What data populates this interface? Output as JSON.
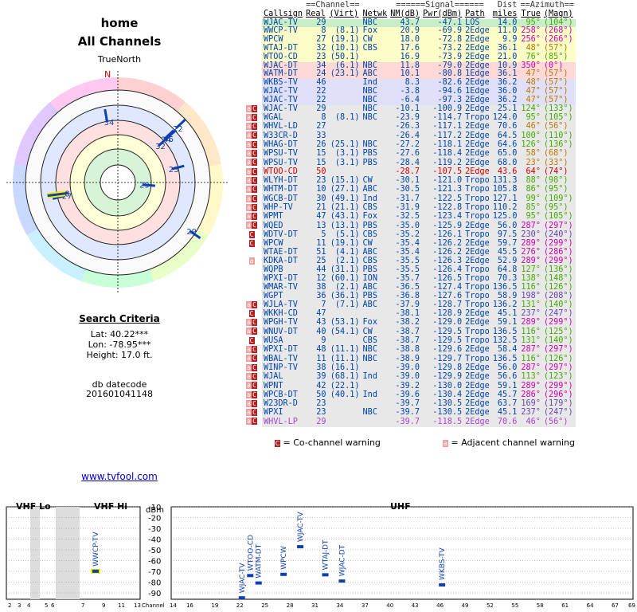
{
  "header": {
    "title": "home",
    "subtitle": "All Channels",
    "true_north": "TrueNorth",
    "north_label": "N"
  },
  "criteria": {
    "title": "Search Criteria",
    "lat": "Lat: 40.22***",
    "lon": "Lon: -78.95***",
    "height": "Height: 17.0 ft.",
    "db_label": "db datecode",
    "db_code": "201601041148"
  },
  "footer_link": "www.tvfool.com",
  "legend": {
    "co": "= Co-channel warning",
    "adj": "= Adjacent channel warning",
    "co_icon": "C",
    "adj_icon": "a"
  },
  "table": {
    "group_headers": [
      "==Channel==",
      "======Signal======",
      "Dist",
      "==Azimuth=="
    ],
    "headers": [
      "Callsign",
      "Real",
      "(Virt)",
      "Netwk",
      "NM(dB)",
      "Pwr(dBm)",
      "Path",
      "miles",
      "True",
      "(Magn)"
    ],
    "rows": [
      {
        "w": "",
        "cs": "WJAC-TV",
        "real": "29",
        "virt": "",
        "net": "NBC",
        "nm": "43.7",
        "pwr": "-47.1",
        "path": "LOS",
        "dist": "14.0",
        "az": "95°",
        "mag": "(104°)"
      },
      {
        "w": "",
        "cs": "WWCP-TV",
        "real": "8",
        "virt": "(8.1)",
        "net": "Fox",
        "nm": "20.9",
        "pwr": "-69.9",
        "path": "2Edge",
        "dist": "11.0",
        "az": "258°",
        "mag": "(268°)"
      },
      {
        "w": "",
        "cs": "WPCW",
        "real": "27",
        "virt": "(19.1)",
        "net": "CW",
        "nm": "18.0",
        "pwr": "-72.8",
        "path": "2Edge",
        "dist": "9.9",
        "az": "256°",
        "mag": "(266°)"
      },
      {
        "w": "",
        "cs": "WTAJ-DT",
        "real": "32",
        "virt": "(10.1)",
        "net": "CBS",
        "nm": "17.6",
        "pwr": "-73.2",
        "path": "2Edge",
        "dist": "36.1",
        "az": "48°",
        "mag": "(57°)"
      },
      {
        "w": "",
        "cs": "WTOO-CD",
        "real": "23",
        "virt": "(50.1)",
        "net": "",
        "nm": "16.9",
        "pwr": "-73.9",
        "path": "2Edge",
        "dist": "21.0",
        "az": "76°",
        "mag": "(85°)"
      },
      {
        "w": "",
        "cs": "WJAC-DT",
        "real": "34",
        "virt": "(6.1)",
        "net": "NBC",
        "nm": "11.8",
        "pwr": "-79.0",
        "path": "2Edge",
        "dist": "10.9",
        "az": "350°",
        "mag": "(0°)"
      },
      {
        "w": "",
        "cs": "WATM-DT",
        "real": "24",
        "virt": "(23.1)",
        "net": "ABC",
        "nm": "10.1",
        "pwr": "-80.8",
        "path": "1Edge",
        "dist": "36.1",
        "az": "47°",
        "mag": "(57°)"
      },
      {
        "w": "",
        "cs": "WKBS-TV",
        "real": "46",
        "virt": "",
        "net": "Ind",
        "nm": "8.3",
        "pwr": "-82.6",
        "path": "2Edge",
        "dist": "36.2",
        "az": "48°",
        "mag": "(57°)"
      },
      {
        "w": "",
        "cs": "WJAC-TV",
        "real": "22",
        "virt": "",
        "net": "NBC",
        "nm": "-3.8",
        "pwr": "-94.6",
        "path": "1Edge",
        "dist": "36.0",
        "az": "47°",
        "mag": "(57°)"
      },
      {
        "w": "",
        "cs": "WJAC-TV",
        "real": "22",
        "virt": "",
        "net": "NBC",
        "nm": "-6.4",
        "pwr": "-97.3",
        "path": "2Edge",
        "dist": "36.2",
        "az": "47°",
        "mag": "(57°)"
      },
      {
        "w": "aC",
        "cs": "WJAC-TV",
        "real": "29",
        "virt": "",
        "net": "NBC",
        "nm": "-10.1",
        "pwr": "-100.9",
        "path": "2Edge",
        "dist": "25.1",
        "az": "124°",
        "mag": "(133°)"
      },
      {
        "w": "aC",
        "cs": "WGAL",
        "real": "8",
        "virt": "(8.1)",
        "net": "NBC",
        "nm": "-23.9",
        "pwr": "-114.7",
        "path": "Tropo",
        "dist": "124.0",
        "az": "95°",
        "mag": "(105°)"
      },
      {
        "w": "aC",
        "cs": "WHVL-LD",
        "real": "27",
        "virt": "",
        "net": "",
        "nm": "-26.3",
        "pwr": "-117.1",
        "path": "2Edge",
        "dist": "70.6",
        "az": "46°",
        "mag": "(56°)"
      },
      {
        "w": "aC",
        "cs": "W33CR-D",
        "real": "33",
        "virt": "",
        "net": "",
        "nm": "-26.4",
        "pwr": "-117.2",
        "path": "2Edge",
        "dist": "64.5",
        "az": "100°",
        "mag": "(110°)"
      },
      {
        "w": "aC",
        "cs": "WHAG-DT",
        "real": "26",
        "virt": "(25.1)",
        "net": "NBC",
        "nm": "-27.2",
        "pwr": "-118.1",
        "path": "2Edge",
        "dist": "64.6",
        "az": "126°",
        "mag": "(136°)"
      },
      {
        "w": "aC",
        "cs": "WPSU-TV",
        "real": "15",
        "virt": "(3.1)",
        "net": "PBS",
        "nm": "-27.6",
        "pwr": "-118.4",
        "path": "2Edge",
        "dist": "65.0",
        "az": "58°",
        "mag": "(68°)"
      },
      {
        "w": "aC",
        "cs": "WPSU-TV",
        "real": "15",
        "virt": "(3.1)",
        "net": "PBS",
        "nm": "-28.4",
        "pwr": "-119.2",
        "path": "2Edge",
        "dist": "68.0",
        "az": "23°",
        "mag": "(33°)"
      },
      {
        "w": "aC",
        "cs": "WTOO-CD",
        "real": "50",
        "virt": "",
        "net": "",
        "nm": "-28.7",
        "pwr": "-107.5",
        "path": "2Edge",
        "dist": "43.6",
        "az": "64°",
        "mag": "(74°)"
      },
      {
        "w": "aC",
        "cs": "WLYH-DT",
        "real": "23",
        "virt": "(15.1)",
        "net": "CW",
        "nm": "-30.1",
        "pwr": "-121.0",
        "path": "Tropo",
        "dist": "131.3",
        "az": "88°",
        "mag": "(98°)"
      },
      {
        "w": "aC",
        "cs": "WHTM-DT",
        "real": "10",
        "virt": "(27.1)",
        "net": "ABC",
        "nm": "-30.5",
        "pwr": "-121.3",
        "path": "Tropo",
        "dist": "105.8",
        "az": "86°",
        "mag": "(95°)"
      },
      {
        "w": "aC",
        "cs": "WGCB-DT",
        "real": "30",
        "virt": "(49.1)",
        "net": "Ind",
        "nm": "-31.7",
        "pwr": "-122.5",
        "path": "Tropo",
        "dist": "127.1",
        "az": "99°",
        "mag": "(109°)"
      },
      {
        "w": "aC",
        "cs": "WHP-TV",
        "real": "21",
        "virt": "(21.1)",
        "net": "CBS",
        "nm": "-31.9",
        "pwr": "-122.8",
        "path": "Tropo",
        "dist": "110.2",
        "az": "85°",
        "mag": "(95°)"
      },
      {
        "w": "aC",
        "cs": "WPMT",
        "real": "47",
        "virt": "(43.1)",
        "net": "Fox",
        "nm": "-32.5",
        "pwr": "-123.4",
        "path": "Tropo",
        "dist": "125.0",
        "az": "95°",
        "mag": "(105°)"
      },
      {
        "w": "aC",
        "cs": "WQED",
        "real": "13",
        "virt": "(13.1)",
        "net": "PBS",
        "nm": "-35.0",
        "pwr": "-125.9",
        "path": "2Edge",
        "dist": "56.0",
        "az": "287°",
        "mag": "(297°)"
      },
      {
        "w": "C",
        "cs": "WDTV-DT",
        "real": "5",
        "virt": "(5.1)",
        "net": "CBS",
        "nm": "-35.2",
        "pwr": "-126.1",
        "path": "Tropo",
        "dist": "97.5",
        "az": "230°",
        "mag": "(240°)"
      },
      {
        "w": "C",
        "cs": "WPCW",
        "real": "11",
        "virt": "(19.1)",
        "net": "CW",
        "nm": "-35.4",
        "pwr": "-126.2",
        "path": "2Edge",
        "dist": "59.7",
        "az": "289°",
        "mag": "(299°)"
      },
      {
        "w": "",
        "cs": "WTAE-DT",
        "real": "51",
        "virt": "(4.1)",
        "net": "ABC",
        "nm": "-35.4",
        "pwr": "-126.2",
        "path": "2Edge",
        "dist": "45.5",
        "az": "276°",
        "mag": "(286°)"
      },
      {
        "w": "a",
        "cs": "KDKA-DT",
        "real": "25",
        "virt": "(2.1)",
        "net": "CBS",
        "nm": "-35.5",
        "pwr": "-126.3",
        "path": "2Edge",
        "dist": "52.9",
        "az": "289°",
        "mag": "(299°)"
      },
      {
        "w": "",
        "cs": "WQPB",
        "real": "44",
        "virt": "(31.1)",
        "net": "PBS",
        "nm": "-35.5",
        "pwr": "-126.4",
        "path": "Tropo",
        "dist": "64.8",
        "az": "127°",
        "mag": "(136°)"
      },
      {
        "w": "",
        "cs": "WPXI-DT",
        "real": "12",
        "virt": "(60.1)",
        "net": "ION",
        "nm": "-35.7",
        "pwr": "-126.5",
        "path": "Tropo",
        "dist": "70.3",
        "az": "138°",
        "mag": "(148°)"
      },
      {
        "w": "",
        "cs": "WMAR-TV",
        "real": "38",
        "virt": "(2.1)",
        "net": "ABC",
        "nm": "-36.5",
        "pwr": "-127.4",
        "path": "Tropo",
        "dist": "136.5",
        "az": "116°",
        "mag": "(126°)"
      },
      {
        "w": "",
        "cs": "WGPT",
        "real": "36",
        "virt": "(36.1)",
        "net": "PBS",
        "nm": "-36.8",
        "pwr": "-127.6",
        "path": "Tropo",
        "dist": "58.9",
        "az": "198°",
        "mag": "(208°)"
      },
      {
        "w": "aC",
        "cs": "WJLA-TV",
        "real": "7",
        "virt": "(7.1)",
        "net": "ABC",
        "nm": "-37.9",
        "pwr": "-128.7",
        "path": "Tropo",
        "dist": "136.2",
        "az": "131°",
        "mag": "(140°)"
      },
      {
        "w": "C",
        "cs": "WKKH-CD",
        "real": "47",
        "virt": "",
        "net": "",
        "nm": "-38.1",
        "pwr": "-128.9",
        "path": "2Edge",
        "dist": "45.1",
        "az": "237°",
        "mag": "(247°)"
      },
      {
        "w": "aC",
        "cs": "WPGH-TV",
        "real": "43",
        "virt": "(53.1)",
        "net": "Fox",
        "nm": "-38.2",
        "pwr": "-129.0",
        "path": "2Edge",
        "dist": "59.1",
        "az": "289°",
        "mag": "(299°)"
      },
      {
        "w": "aC",
        "cs": "WNUV-DT",
        "real": "40",
        "virt": "(54.1)",
        "net": "CW",
        "nm": "-38.7",
        "pwr": "-129.5",
        "path": "Tropo",
        "dist": "136.5",
        "az": "116°",
        "mag": "(125°)"
      },
      {
        "w": "C",
        "cs": "WUSA",
        "real": "9",
        "virt": "",
        "net": "CBS",
        "nm": "-38.7",
        "pwr": "-129.5",
        "path": "Tropo",
        "dist": "132.5",
        "az": "131°",
        "mag": "(140°)"
      },
      {
        "w": "aC",
        "cs": "WPXI-DT",
        "real": "48",
        "virt": "(11.1)",
        "net": "NBC",
        "nm": "-38.8",
        "pwr": "-129.6",
        "path": "2Edge",
        "dist": "58.4",
        "az": "287°",
        "mag": "(297°)"
      },
      {
        "w": "aC",
        "cs": "WBAL-TV",
        "real": "11",
        "virt": "(11.1)",
        "net": "NBC",
        "nm": "-38.9",
        "pwr": "-129.7",
        "path": "Tropo",
        "dist": "136.5",
        "az": "116°",
        "mag": "(126°)"
      },
      {
        "w": "aC",
        "cs": "WINP-TV",
        "real": "38",
        "virt": "(16.1)",
        "net": "",
        "nm": "-39.0",
        "pwr": "-129.8",
        "path": "2Edge",
        "dist": "56.0",
        "az": "287°",
        "mag": "(297°)"
      },
      {
        "w": "aC",
        "cs": "WJAL",
        "real": "39",
        "virt": "(68.1)",
        "net": "Ind",
        "nm": "-39.0",
        "pwr": "-129.9",
        "path": "2Edge",
        "dist": "56.6",
        "az": "113°",
        "mag": "(123°)"
      },
      {
        "w": "aC",
        "cs": "WPNT",
        "real": "42",
        "virt": "(22.1)",
        "net": "",
        "nm": "-39.2",
        "pwr": "-130.0",
        "path": "2Edge",
        "dist": "59.1",
        "az": "289°",
        "mag": "(299°)"
      },
      {
        "w": "aC",
        "cs": "WPCB-DT",
        "real": "50",
        "virt": "(40.1)",
        "net": "Ind",
        "nm": "-39.6",
        "pwr": "-130.4",
        "path": "2Edge",
        "dist": "45.7",
        "az": "286°",
        "mag": "(296°)"
      },
      {
        "w": "aC",
        "cs": "W23DR-D",
        "real": "23",
        "virt": "",
        "net": "",
        "nm": "-39.7",
        "pwr": "-130.5",
        "path": "2Edge",
        "dist": "63.7",
        "az": "169°",
        "mag": "(179°)"
      },
      {
        "w": "aC",
        "cs": "WPXI",
        "real": "23",
        "virt": "",
        "net": "NBC",
        "nm": "-39.7",
        "pwr": "-130.5",
        "path": "2Edge",
        "dist": "45.1",
        "az": "237°",
        "mag": "(247°)"
      },
      {
        "w": "aC",
        "cs": "WHVL-LP",
        "real": "29",
        "virt": "",
        "net": "",
        "nm": "-39.7",
        "pwr": "-118.5",
        "path": "2Edge",
        "dist": "70.6",
        "az": "46°",
        "mag": "(56°)"
      }
    ]
  },
  "chart_data": [
    {
      "type": "scatter",
      "title": "TrueNorth",
      "note": "polar plot of stations: azimuth (deg, true) vs signal",
      "points": [
        {
          "label": "34",
          "az": 350,
          "nm": 11.8
        },
        {
          "label": "22",
          "az": 47,
          "nm": -3.8
        },
        {
          "label": "46",
          "az": 48,
          "nm": 8.3
        },
        {
          "label": "24",
          "az": 47,
          "nm": 10.1
        },
        {
          "label": "32",
          "az": 48,
          "nm": 17.6
        },
        {
          "label": "23",
          "az": 76,
          "nm": 16.9
        },
        {
          "label": "29",
          "az": 95,
          "nm": 43.7
        },
        {
          "label": "29",
          "az": 124,
          "nm": -10.1
        },
        {
          "label": "27",
          "az": 256,
          "nm": 18.0
        },
        {
          "label": "8",
          "az": 258,
          "nm": 20.9
        }
      ]
    },
    {
      "type": "bar",
      "title": "VHF Lo / VHF Hi / UHF spectrum",
      "ylabel": "dBm",
      "xlabel": "Channel",
      "ylim": [
        -90,
        -10
      ],
      "yticks": [
        -10,
        -20,
        -30,
        -40,
        -50,
        -60,
        -70,
        -80,
        -90
      ],
      "sections": [
        {
          "name": "VHF Lo",
          "ticks": [
            "2",
            "3",
            "4",
            "5",
            "6"
          ]
        },
        {
          "name": "VHF Hi",
          "ticks": [
            "7",
            "9",
            "11",
            "13"
          ]
        },
        {
          "name": "UHF",
          "ticks": [
            "14",
            "16",
            "19",
            "22",
            "25",
            "28",
            "31",
            "34",
            "37",
            "40",
            "43",
            "46",
            "49",
            "52",
            "55",
            "58",
            "61",
            "64",
            "67",
            "69"
          ]
        }
      ],
      "stations": [
        {
          "label": "WWCP-TV",
          "channel": 8,
          "dbm": -69.9,
          "highlight": true
        },
        {
          "label": "WJAC-TV",
          "channel": 22,
          "dbm": -94.6
        },
        {
          "label": "WTOO-CD",
          "channel": 23,
          "dbm": -73.9
        },
        {
          "label": "WATM-DT",
          "channel": 24,
          "dbm": -80.8
        },
        {
          "label": "WPCW",
          "channel": 27,
          "dbm": -72.8
        },
        {
          "label": "WJAC-TV",
          "channel": 29,
          "dbm": -47.1
        },
        {
          "label": "WTAJ-DT",
          "channel": 32,
          "dbm": -73.2
        },
        {
          "label": "WJAC-DT",
          "channel": 34,
          "dbm": -79.0
        },
        {
          "label": "WKBS-TV",
          "channel": 46,
          "dbm": -82.6
        }
      ]
    }
  ]
}
